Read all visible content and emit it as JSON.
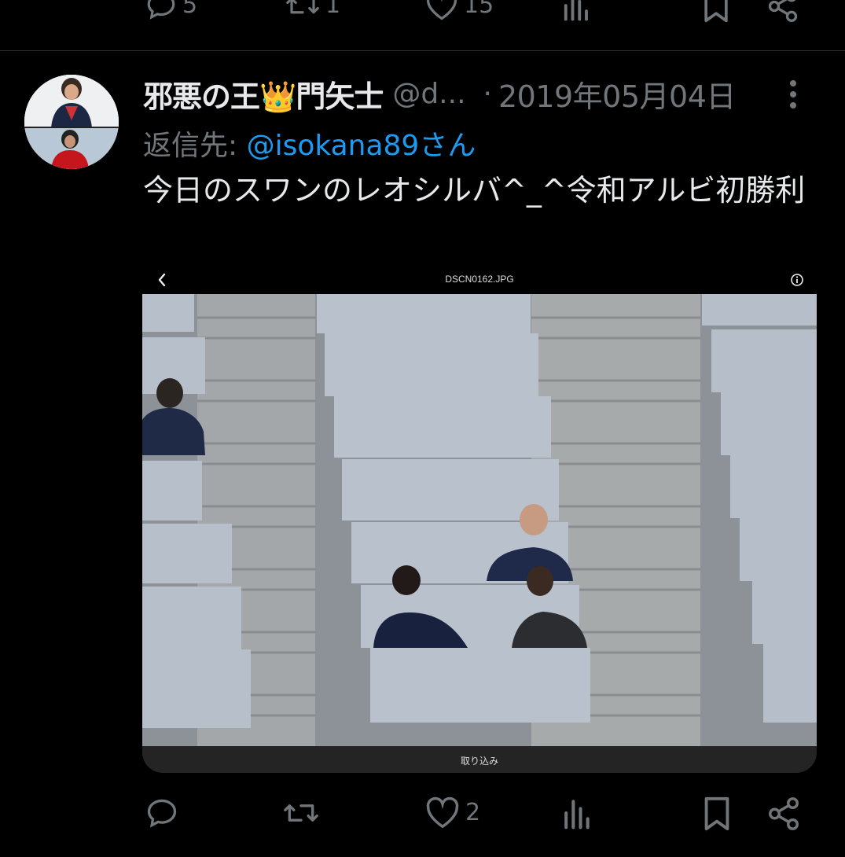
{
  "prev_tweet": {
    "reply_count": "5",
    "retweet_count": "1",
    "like_count": "15"
  },
  "tweet": {
    "display_name": "邪悪の王👑門矢士",
    "handle": "@d...",
    "separator": "·",
    "date": "2019年05月04日",
    "reply_prefix": "返信先: ",
    "reply_to": "@isokana89さん",
    "text": "今日のスワンのレオシルバ^_^令和アルビ初勝利",
    "media": {
      "filename": "DSCN0162.JPG",
      "bottom_label": "取り込み"
    },
    "like_count": "2"
  },
  "colors": {
    "background": "#000000",
    "text": "#e7e9ea",
    "secondary": "#71767b",
    "accent": "#1d9bf0",
    "divider": "#2f3336"
  }
}
